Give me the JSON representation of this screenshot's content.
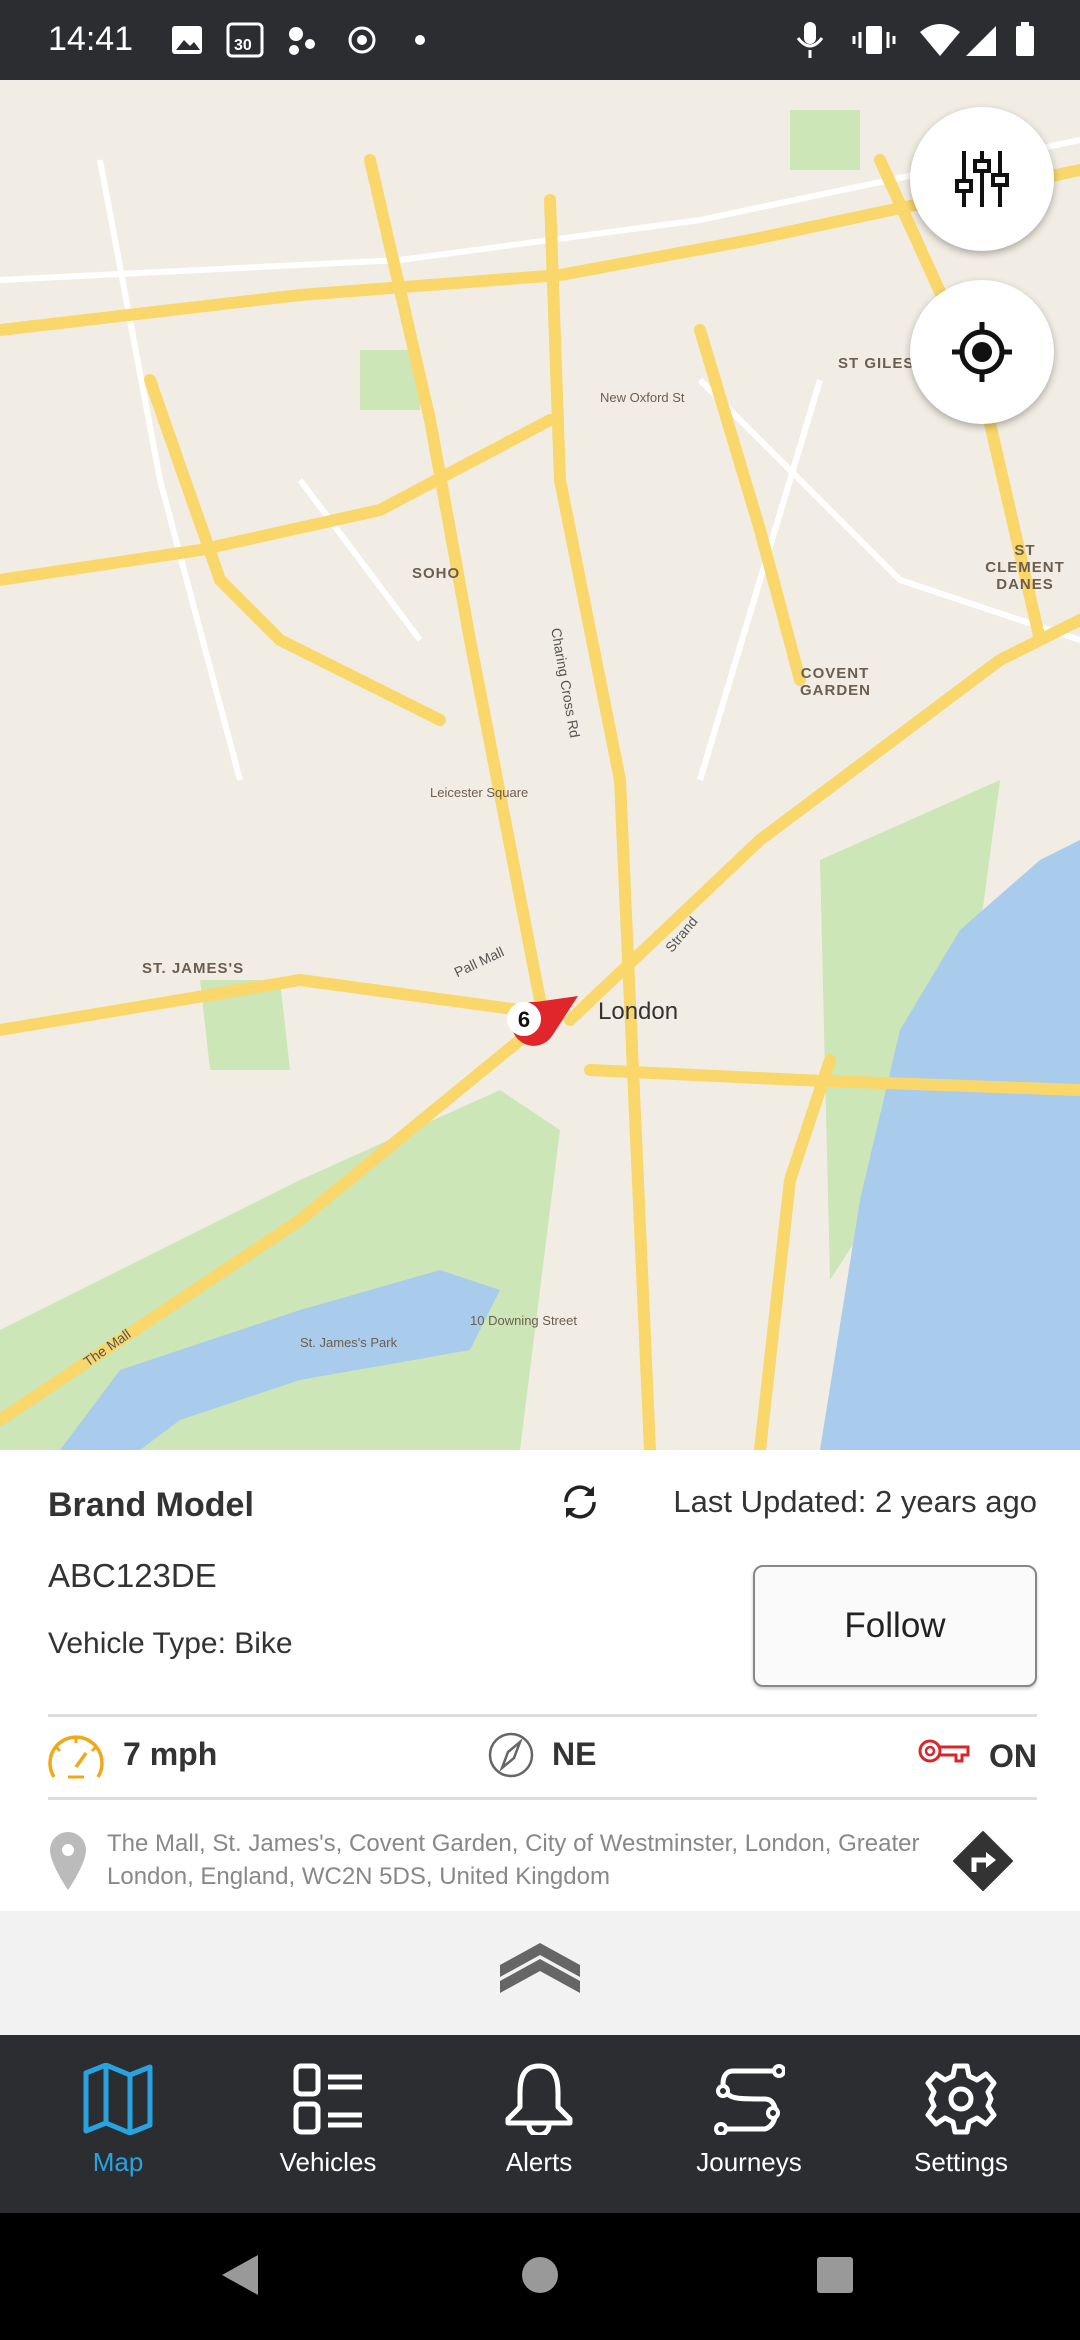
{
  "status_bar": {
    "time": "14:41",
    "calendar_day": "30"
  },
  "map": {
    "labels": {
      "soho": "SOHO",
      "covent_garden": "COVENT GARDEN",
      "st_james": "ST. JAMES'S",
      "st_giles": "ST GILES",
      "st_clement": "ST CLEMENT DANES",
      "london": "London",
      "charing_cross": "Charing Cross Rd",
      "pall_mall": "Pall Mall",
      "the_mall": "The Mall",
      "strand": "Strand",
      "oxford_st": "New Oxford St",
      "st_james_park": "St. James's Park",
      "downing": "10 Downing Street",
      "leicester": "Leicester Square"
    },
    "marker_count": "6",
    "colors": {
      "land": "#f2ede4",
      "road": "#f9d76b",
      "park": "#cde6b8",
      "water": "#a9cbec",
      "marker": "#e0262b"
    }
  },
  "vehicle": {
    "name": "Brand Model",
    "last_updated": "Last Updated: 2 years ago",
    "registration": "ABC123DE",
    "vehicle_type": "Vehicle Type: Bike",
    "follow_label": "Follow",
    "speed": "7 mph",
    "heading": "NE",
    "ignition": "ON",
    "address": "The Mall, St. James's, Covent Garden, City of Westminster, London, Greater London, England, WC2N 5DS, United Kingdom"
  },
  "nav": {
    "items": [
      {
        "label": "Map",
        "active": true
      },
      {
        "label": "Vehicles"
      },
      {
        "label": "Alerts"
      },
      {
        "label": "Journeys"
      },
      {
        "label": "Settings"
      }
    ],
    "active_color": "#29a3e0"
  }
}
